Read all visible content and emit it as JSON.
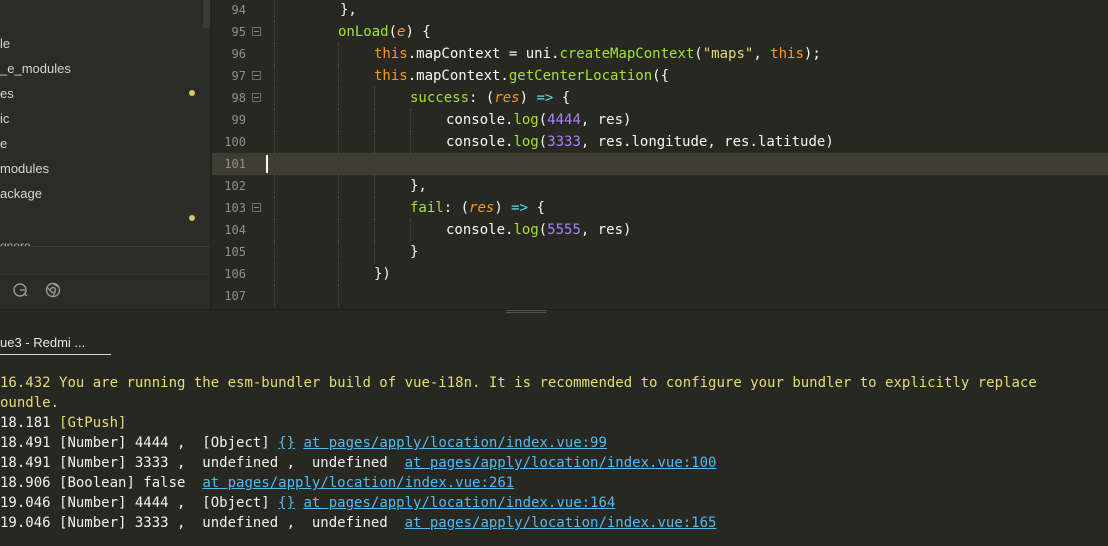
{
  "sidebar": {
    "items": [
      {
        "label": "le",
        "modified": false
      },
      {
        "label": "_e_modules",
        "modified": false
      },
      {
        "label": "es",
        "modified": true
      },
      {
        "label": "ic",
        "modified": false
      },
      {
        "label": "e",
        "modified": false
      },
      {
        "label": "modules",
        "modified": false
      },
      {
        "label": "ackage",
        "modified": false
      },
      {
        "label": "",
        "modified": true
      },
      {
        "label": "gnore",
        "modified": false
      }
    ],
    "icons": [
      "refresh-icon",
      "browser-icon"
    ]
  },
  "editor": {
    "line_numbers": [
      "94",
      "95",
      "96",
      "97",
      "98",
      "99",
      "100",
      "101",
      "102",
      "103",
      "104",
      "105",
      "106",
      "107"
    ],
    "code": {
      "l94": "},",
      "l95_fn": "onLoad",
      "l95_param": "e",
      "l96_this": "this",
      "l96_a": ".mapContext = uni.",
      "l96_fn": "createMapContext",
      "l96_str": "\"maps\"",
      "l96_this2": "this",
      "l97_this": "this",
      "l97_a": ".mapContext.",
      "l97_fn": "getCenterLocation",
      "l98_key": "success",
      "l98_param": "res",
      "l99_a": "console.",
      "l99_fn": "log",
      "l99_num": "4444",
      "l99_b": ", res)",
      "l100_a": "console.",
      "l100_fn": "log",
      "l100_num": "3333",
      "l100_b": ", res.longitude, res.latitude)",
      "l102": "},",
      "l103_key": "fail",
      "l103_param": "res",
      "l104_a": "console.",
      "l104_fn": "log",
      "l104_num": "5555",
      "l104_b": ", res)",
      "l105": "}",
      "l106": "})"
    }
  },
  "console": {
    "tab_label": "ue3 - Redmi ...",
    "lines": [
      {
        "time": "16.432",
        "text": "You are running the esm-bundler build of vue-i18n. It is recommended to configure your bundler to explicitly replace"
      },
      {
        "time": "",
        "text": "oundle."
      },
      {
        "time": "18.181",
        "text": "[GtPush]"
      },
      {
        "time": "18.491",
        "text": "[Number] 4444 ,  [Object] ",
        "braces": "{}",
        "link": "at pages/apply/location/index.vue:99"
      },
      {
        "time": "18.491",
        "text": "[Number] 3333 ,  undefined ,  undefined  ",
        "link": "at pages/apply/location/index.vue:100"
      },
      {
        "time": "18.906",
        "text": "[Boolean] false  ",
        "link": "at pages/apply/location/index.vue:261"
      },
      {
        "time": "19.046",
        "text": "[Number] 4444 ,  [Object] ",
        "braces": "{}",
        "link": "at pages/apply/location/index.vue:164"
      },
      {
        "time": "19.046",
        "text": "[Number] 3333 ,  undefined ,  undefined  ",
        "link": "at pages/apply/location/index.vue:165"
      }
    ]
  }
}
